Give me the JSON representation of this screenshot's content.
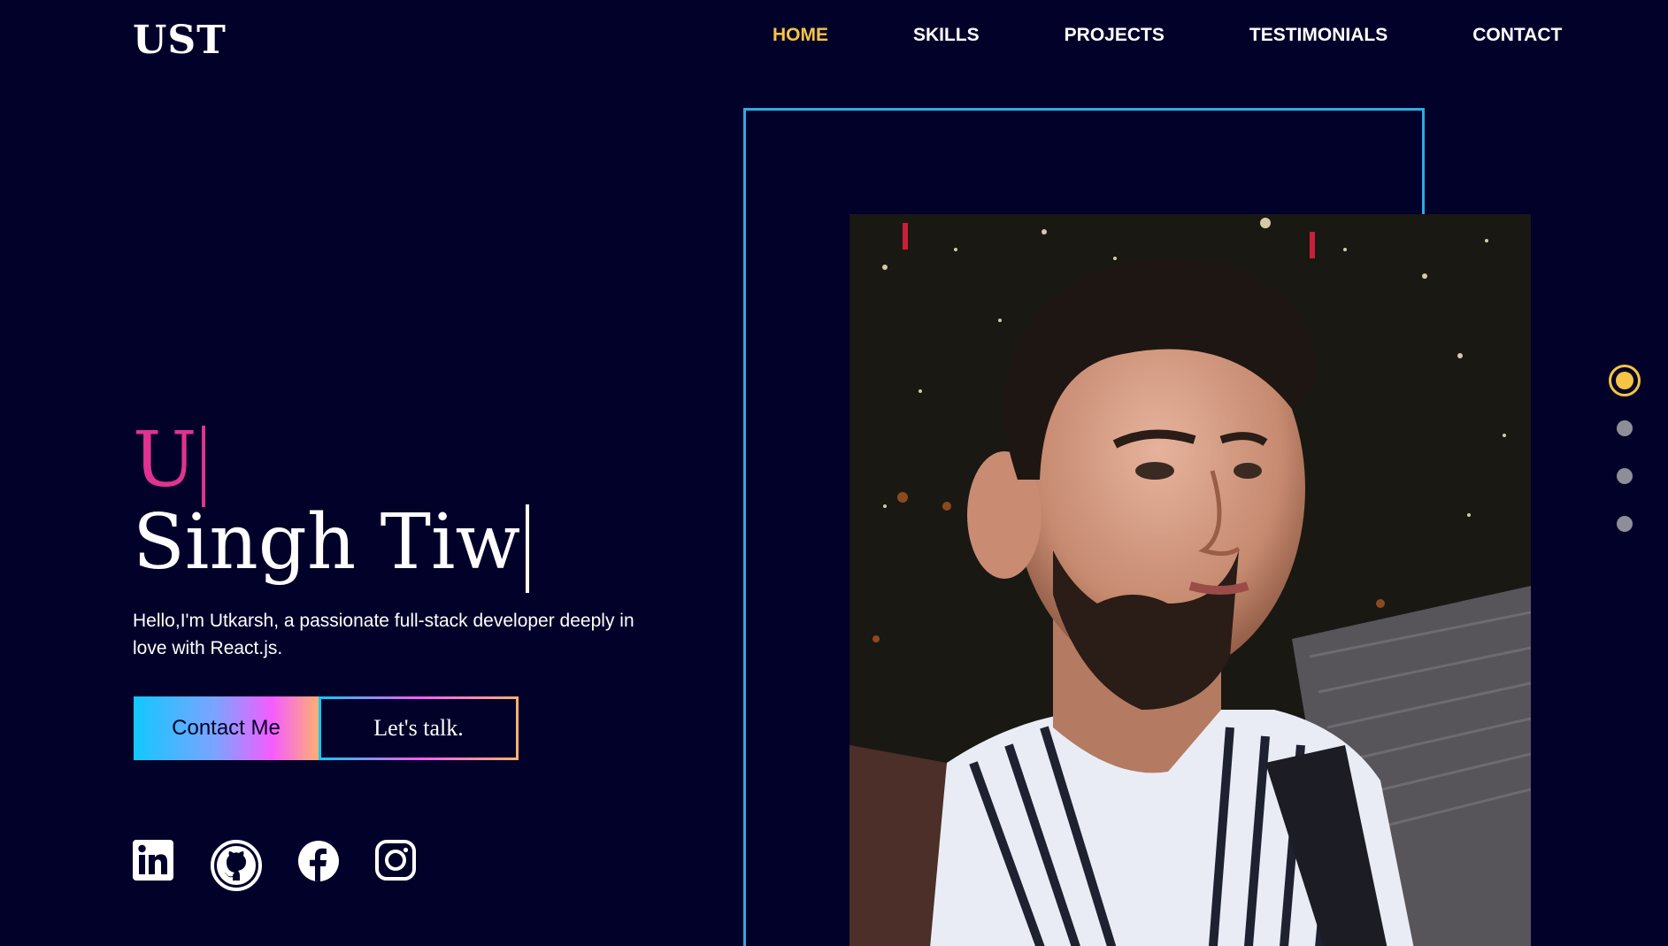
{
  "header": {
    "logo": "UST",
    "nav": [
      {
        "label": "HOME",
        "active": true
      },
      {
        "label": "SKILLS",
        "active": false
      },
      {
        "label": "PROJECTS",
        "active": false
      },
      {
        "label": "TESTIMONIALS",
        "active": false
      },
      {
        "label": "CONTACT",
        "active": false
      }
    ]
  },
  "hero": {
    "typed_line_1": "U",
    "typed_line_2": "Singh Tiw",
    "intro": "Hello,I'm Utkarsh, a passionate full-stack developer deeply in love with React.js.",
    "contact_button": "Contact Me",
    "talk_button": "Let's talk."
  },
  "socials": [
    "linkedin-icon",
    "github-icon",
    "facebook-icon",
    "instagram-icon"
  ],
  "side_nav": {
    "count": 4,
    "active_index": 0
  },
  "colors": {
    "background": "#02012a",
    "accent": "#f7c443",
    "frame": "#2eaae1",
    "typed_pink": "#e0338f"
  }
}
